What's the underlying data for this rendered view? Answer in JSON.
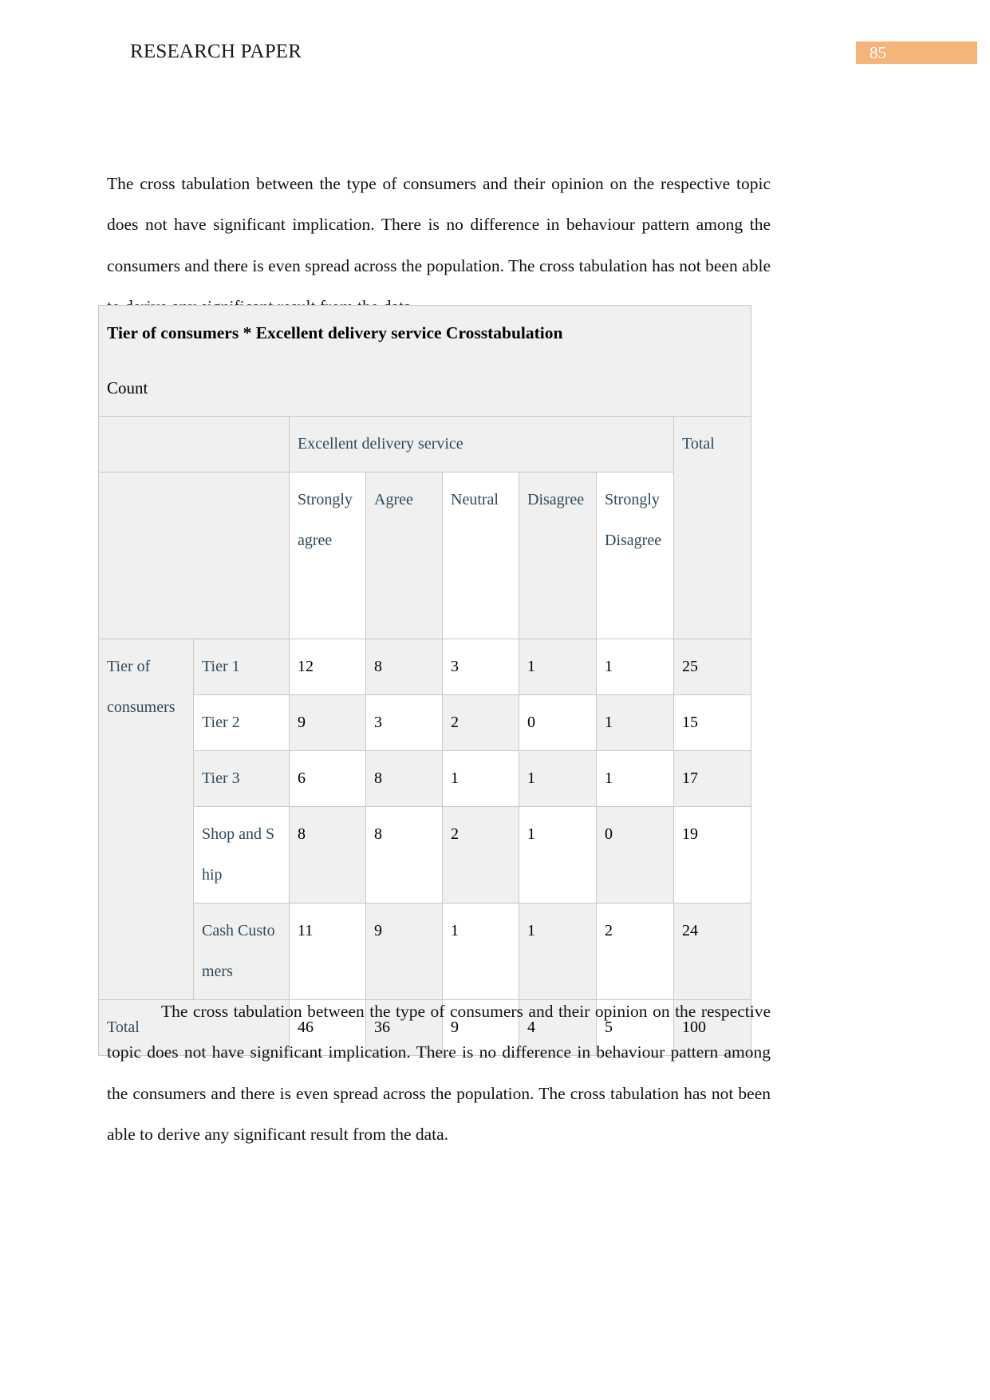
{
  "header": {
    "title": "RESEARCH PAPER",
    "page_number": "85",
    "badge_color": "#f5b47a"
  },
  "body": {
    "paragraph_intro": "The cross tabulation between the type of consumers and their opinion on the respective topic does not have significant implication. There is no difference in behaviour pattern among the consumers and there is even spread across the population. The cross tabulation has not been able to derive any significant result from the data.",
    "paragraph_outro": "The cross tabulation between the type of consumers and their opinion on the respective topic does not have significant implication. There is no difference in behaviour pattern among the consumers and there is even spread across the population. The cross tabulation has not been able to derive any significant result from the data."
  },
  "table": {
    "title": "Tier of consumers  * Excellent delivery service Crosstabulation",
    "measure_label": "Count",
    "column_group_header": "Excellent delivery service",
    "total_header": "Total",
    "row_group_label": "Tier of consumers",
    "row_group_label_line1": "Tier of",
    "row_group_label_line2": "consumers",
    "column_headers": [
      "Strongly agree",
      "Agree",
      "Neutral",
      "Disagree",
      "Strongly Disagree"
    ],
    "total_row_label": "Total",
    "rows": [
      {
        "label": "Tier 1",
        "values": [
          "12",
          "8",
          "3",
          "1",
          "1"
        ],
        "total": "25"
      },
      {
        "label": "Tier 2",
        "values": [
          "9",
          "3",
          "2",
          "0",
          "1"
        ],
        "total": "15"
      },
      {
        "label": "Tier 3",
        "values": [
          "6",
          "8",
          "1",
          "1",
          "1"
        ],
        "total": "17"
      },
      {
        "label": "Shop and Ship",
        "values": [
          "8",
          "8",
          "2",
          "1",
          "0"
        ],
        "total": "19"
      },
      {
        "label": "Cash Customers",
        "values": [
          "11",
          "9",
          "1",
          "1",
          "2"
        ],
        "total": "24"
      }
    ],
    "totals": {
      "values": [
        "46",
        "36",
        "9",
        "4",
        "5"
      ],
      "total": "100"
    }
  },
  "chart_data": {
    "type": "table",
    "title": "Tier of consumers  * Excellent delivery service Crosstabulation",
    "xlabel": "Excellent delivery service",
    "ylabel": "Tier of consumers",
    "categories": [
      "Strongly agree",
      "Agree",
      "Neutral",
      "Disagree",
      "Strongly Disagree"
    ],
    "series": [
      {
        "name": "Tier 1",
        "values": [
          12,
          8,
          3,
          1,
          1
        ],
        "total": 25
      },
      {
        "name": "Tier 2",
        "values": [
          9,
          3,
          2,
          0,
          1
        ],
        "total": 15
      },
      {
        "name": "Tier 3",
        "values": [
          6,
          8,
          1,
          1,
          1
        ],
        "total": 17
      },
      {
        "name": "Shop and Ship",
        "values": [
          8,
          8,
          2,
          1,
          0
        ],
        "total": 19
      },
      {
        "name": "Cash Customers",
        "values": [
          11,
          9,
          1,
          1,
          2
        ],
        "total": 24
      }
    ],
    "column_totals": [
      46,
      36,
      9,
      4,
      5
    ],
    "grand_total": 100
  }
}
